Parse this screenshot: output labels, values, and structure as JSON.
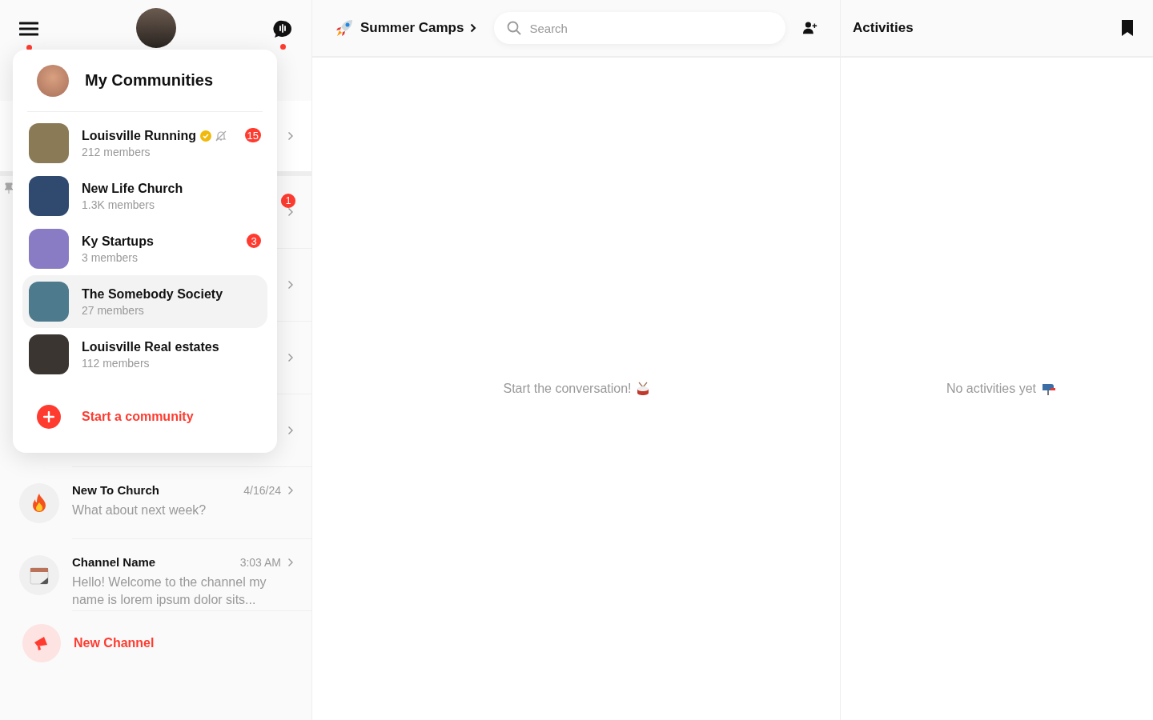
{
  "sidebar": {
    "menu_has_notification": true,
    "chat_has_notification": true,
    "covered_channels": [
      {
        "pinned": false
      },
      {
        "pinned": true,
        "badge": "1"
      },
      {
        "pinned": false
      },
      {
        "pinned": false
      },
      {
        "pinned": false
      }
    ],
    "channels": [
      {
        "kind": "fire",
        "name": "New To Church",
        "time": "4/16/24",
        "preview": "What about next week?"
      },
      {
        "kind": "calendar",
        "name": "Channel Name",
        "time": "3:03 AM",
        "preview": "Hello! Welcome to the channel my name is lorem ipsum dolor sits..."
      }
    ],
    "new_channel": "New Channel"
  },
  "community_menu": {
    "title": "My Communities",
    "communities": [
      {
        "name": "Louisville Running",
        "members": "212 members",
        "verified": true,
        "muted": true,
        "badge": "15",
        "selected": false,
        "color": "#8a7a55"
      },
      {
        "name": "New Life Church",
        "members": "1.3K members",
        "verified": false,
        "muted": false,
        "selected": false,
        "color": "#2f4a6e"
      },
      {
        "name": "Ky Startups",
        "members": "3 members",
        "verified": false,
        "muted": false,
        "badge": "3",
        "selected": false,
        "color": "#8a7cc4"
      },
      {
        "name": "The Somebody Society",
        "members": "27 members",
        "verified": false,
        "muted": false,
        "selected": true,
        "color": "#4d7a8c"
      },
      {
        "name": "Louisville Real estates",
        "members": "112 members",
        "verified": false,
        "muted": false,
        "selected": false,
        "color": "#3a3530"
      }
    ],
    "action": "Start a community"
  },
  "chat": {
    "title": "Summer Camps",
    "search": {
      "placeholder": "Search"
    },
    "empty_text": "Start the conversation!"
  },
  "activities": {
    "title": "Activities",
    "empty_text": "No activities yet"
  }
}
